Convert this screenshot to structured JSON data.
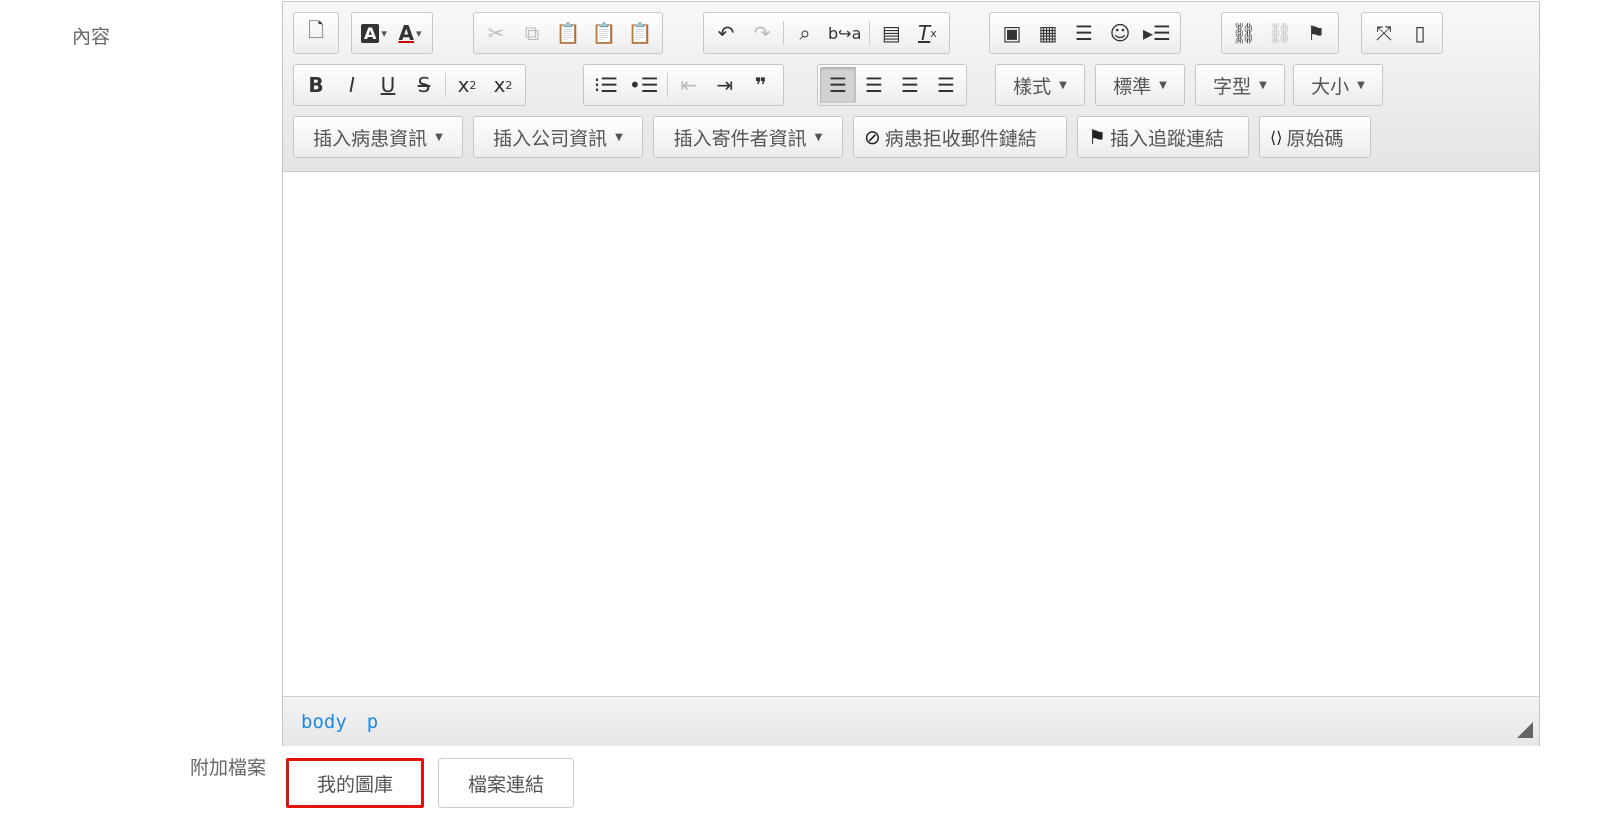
{
  "labels": {
    "content": "內容",
    "attachments": "附加檔案"
  },
  "toolbar_row3": {
    "insert_patient": "插入病患資訊",
    "insert_company": "插入公司資訊",
    "insert_sender": "插入寄件者資訊",
    "patient_reject_link": "病患拒收郵件鏈結",
    "insert_tracking_link": "插入追蹤連結",
    "source": "原始碼"
  },
  "combos": {
    "styles": "樣式",
    "format": "標準",
    "font": "字型",
    "size": "大小"
  },
  "pathbar": [
    "body",
    "p"
  ],
  "attachments": {
    "my_gallery": "我的圖庫",
    "file_link": "檔案連結"
  },
  "icons": {
    "preview": "🔍",
    "text_color": "A",
    "bg_color": "A",
    "cut": "✂",
    "copy": "⧉",
    "paste": "📋",
    "undo": "↶",
    "redo": "↷",
    "find": "🔍",
    "replace": "ab",
    "image": "🖼",
    "table": "▦",
    "hr": "≡",
    "smiley": "☺",
    "link": "🔗",
    "unlink": "⛓",
    "anchor": "⚑",
    "maximize": "⛶",
    "showblocks": "▯",
    "bold": "B",
    "italic": "I",
    "underline": "U",
    "strike": "S",
    "sub": "x₂",
    "sup": "x²",
    "ol": "⒈",
    "ul": "•",
    "outdent": "⇤",
    "indent": "⇥",
    "blockquote": "❞",
    "align_left": "≡",
    "align_center": "≡",
    "align_right": "≡",
    "justify": "≡",
    "flag": "⚑",
    "source": "⟨⟩"
  }
}
